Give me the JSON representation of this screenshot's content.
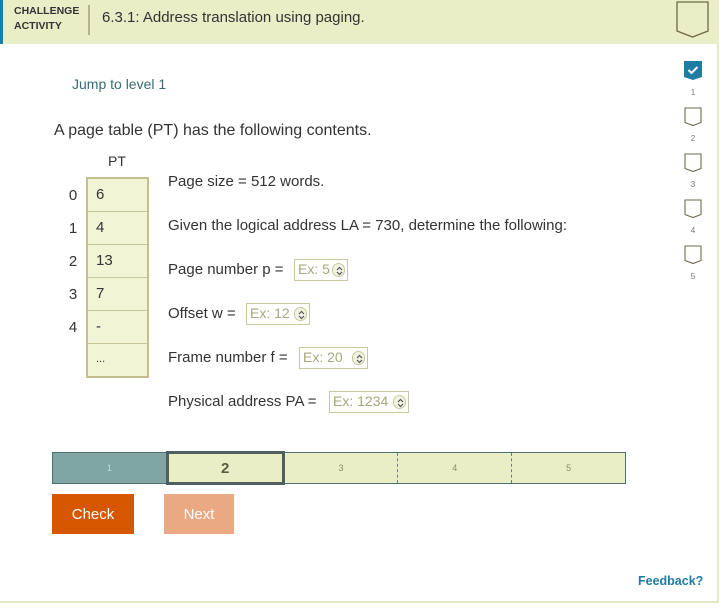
{
  "header": {
    "label": "CHALLENGE ACTIVITY",
    "title": "6.3.1: Address translation using paging."
  },
  "jump_link": "Jump to level 1",
  "intro": "A page table (PT) has the following contents.",
  "page_table": {
    "title": "PT",
    "rows": [
      {
        "index": "0",
        "value": "6"
      },
      {
        "index": "1",
        "value": "4"
      },
      {
        "index": "2",
        "value": "13"
      },
      {
        "index": "3",
        "value": "7"
      },
      {
        "index": "4",
        "value": "-"
      },
      {
        "index": "",
        "value": "..."
      }
    ]
  },
  "question": {
    "page_size": "Page size = 512 words.",
    "given": "Given the logical address LA = 730, determine the following:",
    "fields": [
      {
        "label": "Page number p =",
        "placeholder": "Ex: 5",
        "value": ""
      },
      {
        "label": "Offset w =",
        "placeholder": "Ex: 12",
        "value": ""
      },
      {
        "label": "Frame number f =",
        "placeholder": "Ex: 20",
        "value": ""
      },
      {
        "label": "Physical address PA =",
        "placeholder": "Ex: 1234",
        "value": ""
      }
    ]
  },
  "levels": {
    "items": [
      "1",
      "2",
      "3",
      "4",
      "5"
    ],
    "completed": [
      1
    ],
    "current": 2
  },
  "buttons": {
    "check": "Check",
    "next": "Next"
  },
  "feedback": "Feedback?",
  "side_levels": [
    {
      "num": "1",
      "completed": true
    },
    {
      "num": "2",
      "completed": false
    },
    {
      "num": "3",
      "completed": false
    },
    {
      "num": "4",
      "completed": false
    },
    {
      "num": "5",
      "completed": false
    }
  ],
  "colors": {
    "accent": "#1a7fa8",
    "check_button": "#d75600",
    "next_button": "#eba983",
    "header_bg": "#eaeec7",
    "completed_level": "#7fa6a4",
    "checkmark_bg": "#1f7ca3"
  }
}
